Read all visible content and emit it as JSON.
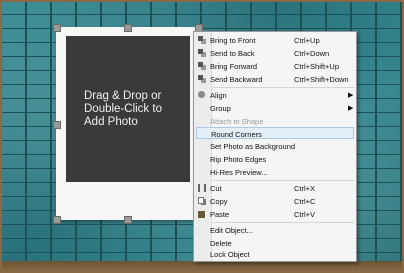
{
  "photo": {
    "placeholder": "Drag & Drop or\nDouble-Click to\nAdd Photo"
  },
  "menu": {
    "items": [
      {
        "label": "Bring to Front",
        "shortcut": "Ctrl+Up",
        "icon": "bring-to-front-icon"
      },
      {
        "label": "Send to Back",
        "shortcut": "Ctrl+Down",
        "icon": "send-to-back-icon"
      },
      {
        "label": "Bring Forward",
        "shortcut": "Ctrl+Shift+Up",
        "icon": "bring-forward-icon"
      },
      {
        "label": "Send Backward",
        "shortcut": "Ctrl+Shift+Down",
        "icon": "send-backward-icon"
      },
      {
        "label": "Align",
        "submenu": true,
        "icon": "align-icon"
      },
      {
        "label": "Group",
        "submenu": true
      },
      {
        "label": "Attach to Shape",
        "disabled": true
      },
      {
        "label": "Round Corners",
        "highlighted": true
      },
      {
        "label": "Set Photo as Background"
      },
      {
        "label": "Rip Photo Edges"
      },
      {
        "label": "Hi-Res Preview..."
      },
      {
        "label": "Cut",
        "shortcut": "Ctrl+X",
        "icon": "cut-icon"
      },
      {
        "label": "Copy",
        "shortcut": "Ctrl+C",
        "icon": "copy-icon"
      },
      {
        "label": "Paste",
        "shortcut": "Ctrl+V",
        "icon": "paste-icon"
      },
      {
        "label": "Edit Object..."
      },
      {
        "label": "Delete"
      },
      {
        "label": "Lock Object"
      }
    ],
    "submenu_arrow": "▶"
  }
}
